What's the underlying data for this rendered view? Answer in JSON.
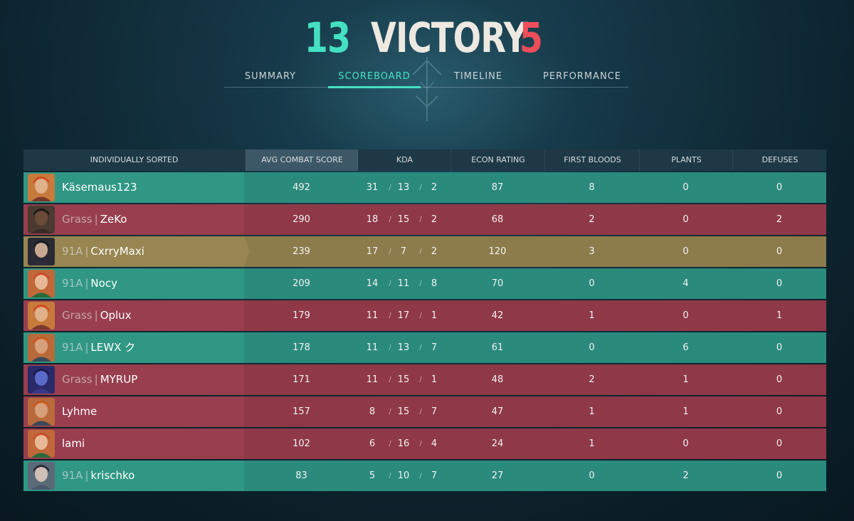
{
  "header": {
    "score_left": "13",
    "result": "VICTORY",
    "score_right": "5",
    "colors": {
      "win": "#45e0c2",
      "loss": "#ef4d5a",
      "title": "#ede9e1"
    }
  },
  "tabs": [
    {
      "label": "SUMMARY",
      "active": false
    },
    {
      "label": "SCOREBOARD",
      "active": true
    },
    {
      "label": "TIMELINE",
      "active": false
    },
    {
      "label": "PERFORMANCE",
      "active": false
    }
  ],
  "table": {
    "columns": [
      "INDIVIDUALLY SORTED",
      "AVG COMBAT SCORE",
      "KDA",
      "ECON RATING",
      "FIRST BLOODS",
      "PLANTS",
      "DEFUSES"
    ],
    "sorted_column": "AVG COMBAT SCORE",
    "kda_separator": "/",
    "rows": [
      {
        "team": "a",
        "self": false,
        "tag": "",
        "name": "Käsemaus123",
        "acs": "492",
        "k": "31",
        "d": "13",
        "a": "2",
        "econ": "87",
        "fb": "8",
        "plants": "0",
        "defuses": "0",
        "agent_icon": "agent-1-icon"
      },
      {
        "team": "b",
        "self": false,
        "tag": "Grass",
        "name": "ZeKo",
        "acs": "290",
        "k": "18",
        "d": "15",
        "a": "2",
        "econ": "68",
        "fb": "2",
        "plants": "0",
        "defuses": "2",
        "agent_icon": "agent-2-icon"
      },
      {
        "team": "a",
        "self": true,
        "tag": "91A",
        "name": "CxrryMaxi",
        "acs": "239",
        "k": "17",
        "d": "7",
        "a": "2",
        "econ": "120",
        "fb": "3",
        "plants": "0",
        "defuses": "0",
        "agent_icon": "agent-3-icon"
      },
      {
        "team": "a",
        "self": false,
        "tag": "91A",
        "name": "Nocy",
        "acs": "209",
        "k": "14",
        "d": "11",
        "a": "8",
        "econ": "70",
        "fb": "0",
        "plants": "4",
        "defuses": "0",
        "agent_icon": "agent-4-icon"
      },
      {
        "team": "b",
        "self": false,
        "tag": "Grass",
        "name": "Oplux",
        "acs": "179",
        "k": "11",
        "d": "17",
        "a": "1",
        "econ": "42",
        "fb": "1",
        "plants": "0",
        "defuses": "1",
        "agent_icon": "agent-1-icon"
      },
      {
        "team": "a",
        "self": false,
        "tag": "91A",
        "name": "LEWX ク",
        "acs": "178",
        "k": "11",
        "d": "13",
        "a": "7",
        "econ": "61",
        "fb": "0",
        "plants": "6",
        "defuses": "0",
        "agent_icon": "agent-5-icon"
      },
      {
        "team": "b",
        "self": false,
        "tag": "Grass",
        "name": "MYRUP",
        "acs": "171",
        "k": "11",
        "d": "15",
        "a": "1",
        "econ": "48",
        "fb": "2",
        "plants": "1",
        "defuses": "0",
        "agent_icon": "agent-6-icon"
      },
      {
        "team": "b",
        "self": false,
        "tag": "",
        "name": "Lyhme",
        "acs": "157",
        "k": "8",
        "d": "15",
        "a": "7",
        "econ": "47",
        "fb": "1",
        "plants": "1",
        "defuses": "0",
        "agent_icon": "agent-5-icon"
      },
      {
        "team": "b",
        "self": false,
        "tag": "",
        "name": "lami",
        "acs": "102",
        "k": "6",
        "d": "16",
        "a": "4",
        "econ": "24",
        "fb": "1",
        "plants": "0",
        "defuses": "0",
        "agent_icon": "agent-4-icon"
      },
      {
        "team": "a",
        "self": false,
        "tag": "91A",
        "name": "krischko",
        "acs": "83",
        "k": "5",
        "d": "10",
        "a": "7",
        "econ": "27",
        "fb": "0",
        "plants": "2",
        "defuses": "0",
        "agent_icon": "agent-7-icon"
      }
    ]
  }
}
